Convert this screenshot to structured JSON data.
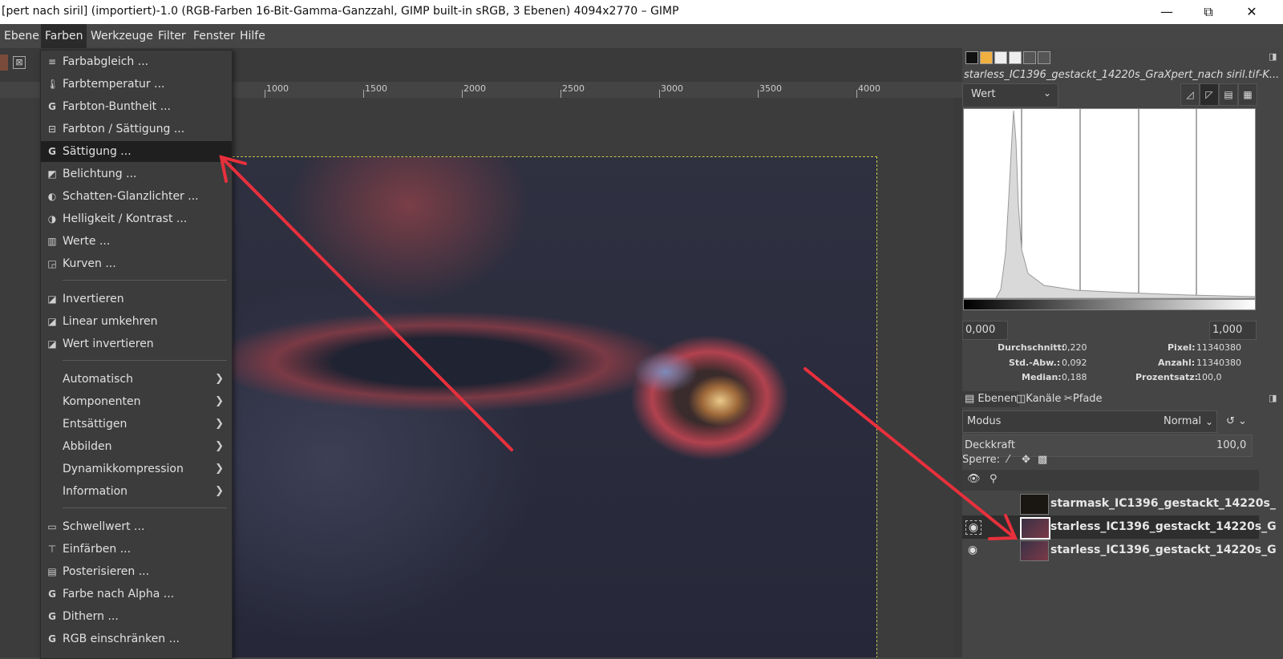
{
  "window": {
    "title": "[pert nach siril] (importiert)-1.0 (RGB-Farben 16-Bit-Gamma-Ganzzahl, GIMP built-in sRGB, 3 Ebenen) 4094x2770 – GIMP",
    "minimize": "—",
    "maximize": "⧉",
    "close": "✕"
  },
  "menubar": [
    "Ebene",
    "Farben",
    "Werkzeuge",
    "Filter",
    "Fenster",
    "Hilfe"
  ],
  "ruler": [
    "1000",
    "1500",
    "2000",
    "2500",
    "3000",
    "3500",
    "4000"
  ],
  "colors_menu": {
    "items": [
      {
        "label": "Farbabgleich ...",
        "icon": "balance-icon"
      },
      {
        "label": "Farbtemperatur ...",
        "icon": "temperature-icon"
      },
      {
        "label": "Farbton-Buntheit ...",
        "icon": "gegl-icon"
      },
      {
        "label": "Farbton / Sättigung ...",
        "icon": "hue-saturation-icon"
      },
      {
        "label": "Sättigung ...",
        "icon": "gegl-icon",
        "highlighted": true
      },
      {
        "label": "Belichtung ...",
        "icon": "exposure-icon"
      },
      {
        "label": "Schatten-Glanzlichter ...",
        "icon": "shadows-highlights-icon"
      },
      {
        "label": "Helligkeit / Kontrast ...",
        "icon": "brightness-contrast-icon"
      },
      {
        "label": "Werte ...",
        "icon": "levels-icon"
      },
      {
        "label": "Kurven ...",
        "icon": "curves-icon"
      },
      {
        "label": "Invertieren",
        "icon": "invert-icon"
      },
      {
        "label": "Linear umkehren",
        "icon": "invert-icon"
      },
      {
        "label": "Wert invertieren",
        "icon": "invert-icon"
      },
      {
        "label": "Automatisch",
        "submenu": true
      },
      {
        "label": "Komponenten",
        "submenu": true
      },
      {
        "label": "Entsättigen",
        "submenu": true
      },
      {
        "label": "Abbilden",
        "submenu": true
      },
      {
        "label": "Dynamikkompression",
        "submenu": true
      },
      {
        "label": "Information",
        "submenu": true
      },
      {
        "label": "Schwellwert ...",
        "icon": "threshold-icon"
      },
      {
        "label": "Einfärben ...",
        "icon": "colorize-icon"
      },
      {
        "label": "Posterisieren ...",
        "icon": "posterize-icon"
      },
      {
        "label": "Farbe nach Alpha ...",
        "icon": "gegl-icon"
      },
      {
        "label": "Dithern ...",
        "icon": "gegl-icon"
      },
      {
        "label": "RGB einschränken ...",
        "icon": "gegl-icon"
      }
    ]
  },
  "histogram": {
    "file_label": "starless_IC1396_gestackt_14220s_GraXpert_nach siril.tif-K...",
    "channel": "Wert",
    "range_min": "0,000",
    "range_max": "1,000",
    "stats": {
      "mean_label": "Durchschnitt:",
      "mean": "0,220",
      "std_label": "Std.-Abw.:",
      "std": "0,092",
      "median_label": "Median:",
      "median": "0,188",
      "pixels_label": "Pixel:",
      "pixels": "11340380",
      "count_label": "Anzahl:",
      "count": "11340380",
      "percent_label": "Prozentsatz:",
      "percent": "100,0"
    }
  },
  "layers_panel": {
    "tabs": [
      "Ebenen",
      "Kanäle",
      "Pfade"
    ],
    "mode_label": "Modus",
    "mode_value": "Normal",
    "opacity_label": "Deckkraft",
    "opacity_value": "100,0",
    "lock_label": "Sperre:",
    "layers": [
      {
        "name": "starmask_IC1396_gestackt_14220s_",
        "visible": false,
        "selected": false
      },
      {
        "name": "starless_IC1396_gestackt_14220s_G",
        "visible": true,
        "selected": true
      },
      {
        "name": "starless_IC1396_gestackt_14220s_G",
        "visible": true,
        "selected": false
      }
    ]
  },
  "annotation_color": "#e8303c"
}
